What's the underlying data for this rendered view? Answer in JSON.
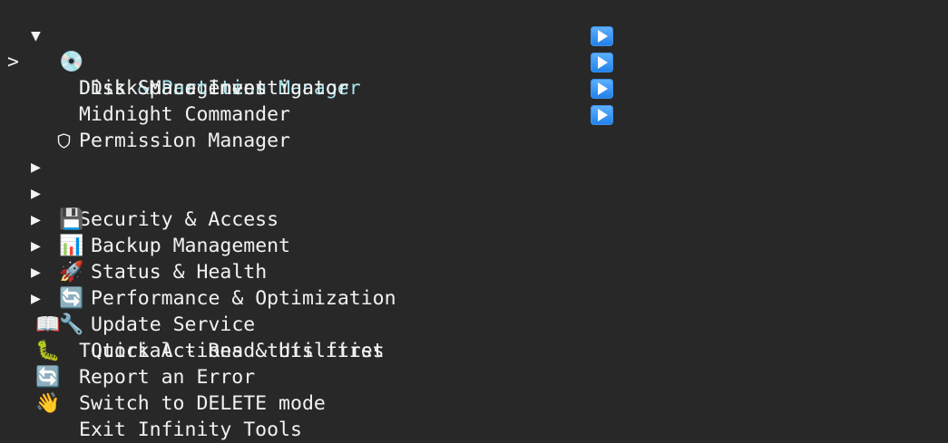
{
  "menu": {
    "disk_management": {
      "arrow": "▼",
      "icon": "💿",
      "label": "Disk Management",
      "icon_name": "disc-icon"
    },
    "disk_items": [
      {
        "label": "Disk & Partition Manager",
        "selected": true
      },
      {
        "label": "Disk Space Investigator",
        "selected": false
      },
      {
        "label": "Midnight Commander",
        "selected": false
      },
      {
        "label": "Permission Manager",
        "selected": false
      }
    ],
    "cursor": ">",
    "run_icon_name": "play-button-icon",
    "collapsed_arrow": "▶",
    "categories": [
      {
        "icon": "",
        "icon_name": "shield-icon",
        "label": "Security & Access"
      },
      {
        "icon": "💾",
        "icon_name": "floppy-disk-icon",
        "label": "Backup Management"
      },
      {
        "icon": "📊",
        "icon_name": "bar-chart-icon",
        "label": "Status & Health"
      },
      {
        "icon": "🚀",
        "icon_name": "rocket-icon",
        "label": "Performance & Optimization"
      },
      {
        "icon": "🔄",
        "icon_name": "refresh-icon",
        "label": "Update Service"
      },
      {
        "icon": "🔧",
        "icon_name": "wrench-icon",
        "label": "Quick Actions & Utilities"
      }
    ],
    "actions": [
      {
        "icon": "📖",
        "icon_name": "book-icon",
        "label": "Tutorial - Read this first"
      },
      {
        "icon": "🐛",
        "icon_name": "bug-icon",
        "label": "Report an Error"
      },
      {
        "icon": "🔄",
        "icon_name": "refresh-icon",
        "label": "Switch to DELETE mode"
      },
      {
        "icon": "👋",
        "icon_name": "waving-hand-icon",
        "label": "Exit Infinity Tools"
      }
    ]
  },
  "colors": {
    "background": "#282828",
    "text": "#f2f2f2",
    "selected_text": "#a8e4ec",
    "run_button": "#2f8cf0"
  }
}
